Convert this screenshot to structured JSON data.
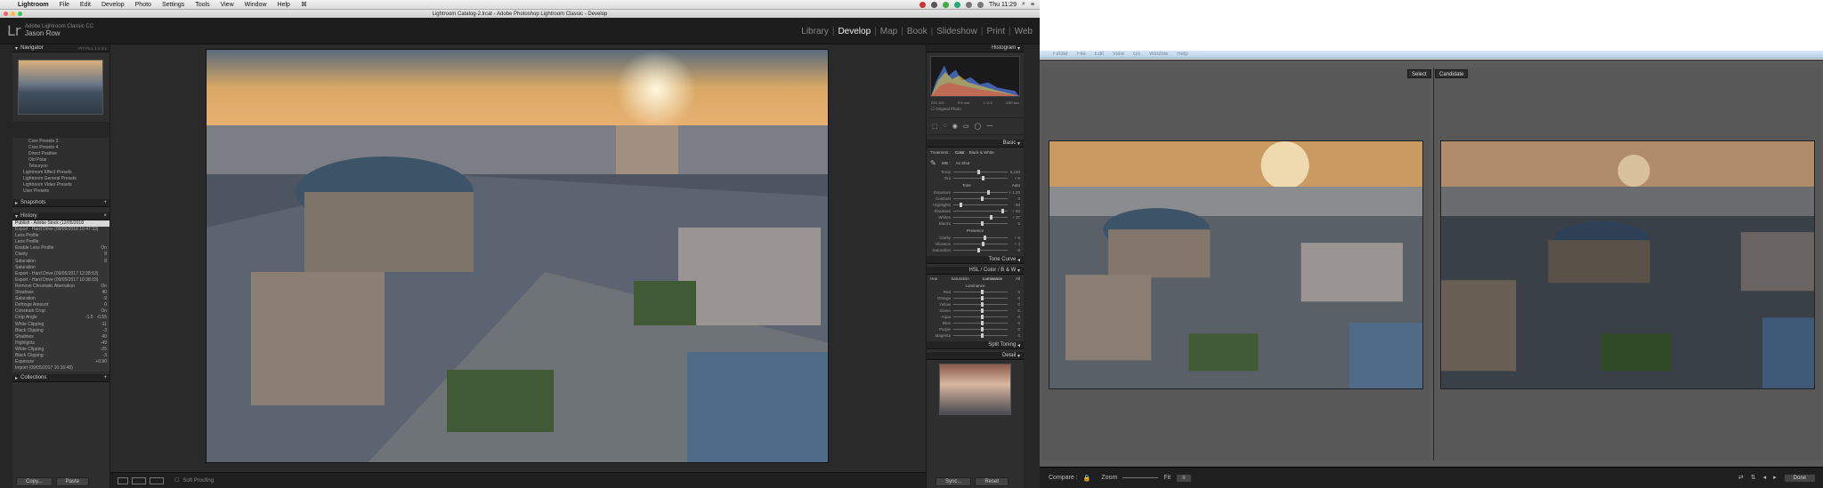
{
  "menubar": {
    "items": [
      "Lightroom",
      "File",
      "Edit",
      "Develop",
      "Photo",
      "Settings",
      "Tools",
      "View",
      "Window",
      "Help"
    ],
    "clock": "Thu 11:29"
  },
  "window_title": "Lightroom Catalog-2.lrcat - Adobe Photoshop Lightroom Classic - Develop",
  "identity": {
    "app": "Adobe Lightroom Classic CC",
    "user": "Jason Row",
    "logo": "Lr"
  },
  "modules": [
    "Library",
    "Develop",
    "Map",
    "Book",
    "Slideshow",
    "Print",
    "Web"
  ],
  "left_panel": {
    "navigator": {
      "title": "Navigator",
      "zoom": [
        "FIT",
        "FILL",
        "1:1",
        "3:1"
      ]
    },
    "presets": [
      "Creo Presets 3",
      "Creo Presets 4",
      "Direct Positive",
      "Old Polar",
      "Tetsuryoo",
      "Lightroom Effect Presets",
      "Lightroom General Presets",
      "Lightroom Video Presets",
      "User Presets"
    ],
    "snapshots_title": "Snapshots",
    "history_title": "History",
    "history": [
      {
        "name": "Publish - Adobe Stock (12/05/2018 13:04:26)",
        "a": "",
        "b": ""
      },
      {
        "name": "Export - Hard Drive (09/05/2018 10:47:33)",
        "a": "",
        "b": ""
      },
      {
        "name": "Lens Profile",
        "a": "",
        "b": ""
      },
      {
        "name": "Lens Profile",
        "a": "",
        "b": ""
      },
      {
        "name": "Enable Lens Profile",
        "a": "",
        "b": "On"
      },
      {
        "name": "Clarity",
        "a": "",
        "b": "8"
      },
      {
        "name": "Saturation",
        "a": "",
        "b": "8"
      },
      {
        "name": "Saturation",
        "a": "",
        "b": ""
      },
      {
        "name": "Export - Hard Drive (09/05/2017 12:28:53)",
        "a": "",
        "b": ""
      },
      {
        "name": "Export - Hard Drive (09/05/2017 10:38:03)",
        "a": "",
        "b": ""
      },
      {
        "name": "Remove Chromatic Aberration",
        "a": "",
        "b": "On"
      },
      {
        "name": "Shadows",
        "a": "",
        "b": "40"
      },
      {
        "name": "Saturation",
        "a": "",
        "b": "-9"
      },
      {
        "name": "Defringe Amount",
        "a": "",
        "b": "0"
      },
      {
        "name": "Constrain Crop",
        "a": "",
        "b": "On"
      },
      {
        "name": "Crop Angle",
        "a": "-1.5",
        "b": "-0.55"
      },
      {
        "name": "White Clipping",
        "a": "",
        "b": "-11"
      },
      {
        "name": "Black Clipping",
        "a": "",
        "b": "-3"
      },
      {
        "name": "Shadows",
        "a": "",
        "b": "40"
      },
      {
        "name": "Highlights",
        "a": "",
        "b": "-49"
      },
      {
        "name": "White Clipping",
        "a": "",
        "b": "-25"
      },
      {
        "name": "Black Clipping",
        "a": "",
        "b": "-3"
      },
      {
        "name": "Exposure",
        "a": "",
        "b": "+0.90"
      },
      {
        "name": "Import (09/05/2017 10:16:48)",
        "a": "",
        "b": ""
      }
    ],
    "collections_title": "Collections",
    "copy_btn": "Copy...",
    "paste_btn": "Paste"
  },
  "toolbar": {
    "soft_proofing": "Soft Proofing"
  },
  "right_panel": {
    "histogram_title": "Histogram",
    "histogram_readout": [
      "ISO 100",
      "8.8 mm",
      "f / 2.8",
      "1/50 sec"
    ],
    "original_photo": "Original Photo",
    "basic_title": "Basic",
    "treatment": {
      "label": "Treatment :",
      "color": "Color",
      "bw": "Black & White"
    },
    "wb": {
      "label": "WB :",
      "value": "As Shot"
    },
    "tone_label": "Tone",
    "auto_label": "Auto",
    "presence_label": "Presence",
    "sliders_wb": [
      {
        "label": "Temp",
        "val": "5,150",
        "pos": 0.45
      },
      {
        "label": "Tint",
        "val": "+ 6",
        "pos": 0.52
      }
    ],
    "sliders_tone": [
      {
        "label": "Exposure",
        "val": "+ 1.20",
        "pos": 0.62
      },
      {
        "label": "Contrast",
        "val": "0",
        "pos": 0.5
      },
      {
        "label": "Highlights",
        "val": "- 83",
        "pos": 0.12
      },
      {
        "label": "Shadows",
        "val": "+ 83",
        "pos": 0.88
      },
      {
        "label": "Whites",
        "val": "+ 37",
        "pos": 0.68
      },
      {
        "label": "Blacks",
        "val": "0",
        "pos": 0.5
      }
    ],
    "sliders_presence": [
      {
        "label": "Clarity",
        "val": "+ 8",
        "pos": 0.55
      },
      {
        "label": "Vibrance",
        "val": "+ 4",
        "pos": 0.52
      },
      {
        "label": "Saturation",
        "val": "- 9",
        "pos": 0.45
      }
    ],
    "tone_curve_title": "Tone Curve",
    "hsl_title": "HSL / Color / B & W",
    "hsl_tabs": [
      "Hue",
      "Saturation",
      "Luminance",
      "All"
    ],
    "luminance_label": "Luminance",
    "sliders_lum": [
      {
        "label": "Red",
        "val": "0",
        "pos": 0.5
      },
      {
        "label": "Orange",
        "val": "0",
        "pos": 0.5
      },
      {
        "label": "Yellow",
        "val": "0",
        "pos": 0.5
      },
      {
        "label": "Green",
        "val": "0",
        "pos": 0.5
      },
      {
        "label": "Aqua",
        "val": "0",
        "pos": 0.5
      },
      {
        "label": "Blue",
        "val": "0",
        "pos": 0.5
      },
      {
        "label": "Purple",
        "val": "0",
        "pos": 0.5
      },
      {
        "label": "Magenta",
        "val": "0",
        "pos": 0.5
      }
    ],
    "split_toning_title": "Split Toning",
    "detail_title": "Detail",
    "sync_btn": "Sync...",
    "reset_btn": "Reset"
  },
  "compare_window": {
    "menubar": [
      "Finder",
      "File",
      "Edit",
      "View",
      "Go",
      "Window",
      "Help"
    ],
    "select_label": "Select",
    "candidate_label": "Candidate",
    "compare_label": "Compare :",
    "zoom_label": "Zoom",
    "fit_label": "Fit",
    "done_btn": "Done"
  },
  "colors": {
    "accent": "#e8e8e8",
    "panel": "#2e2e2e",
    "chrome": "#1d1d1d"
  }
}
